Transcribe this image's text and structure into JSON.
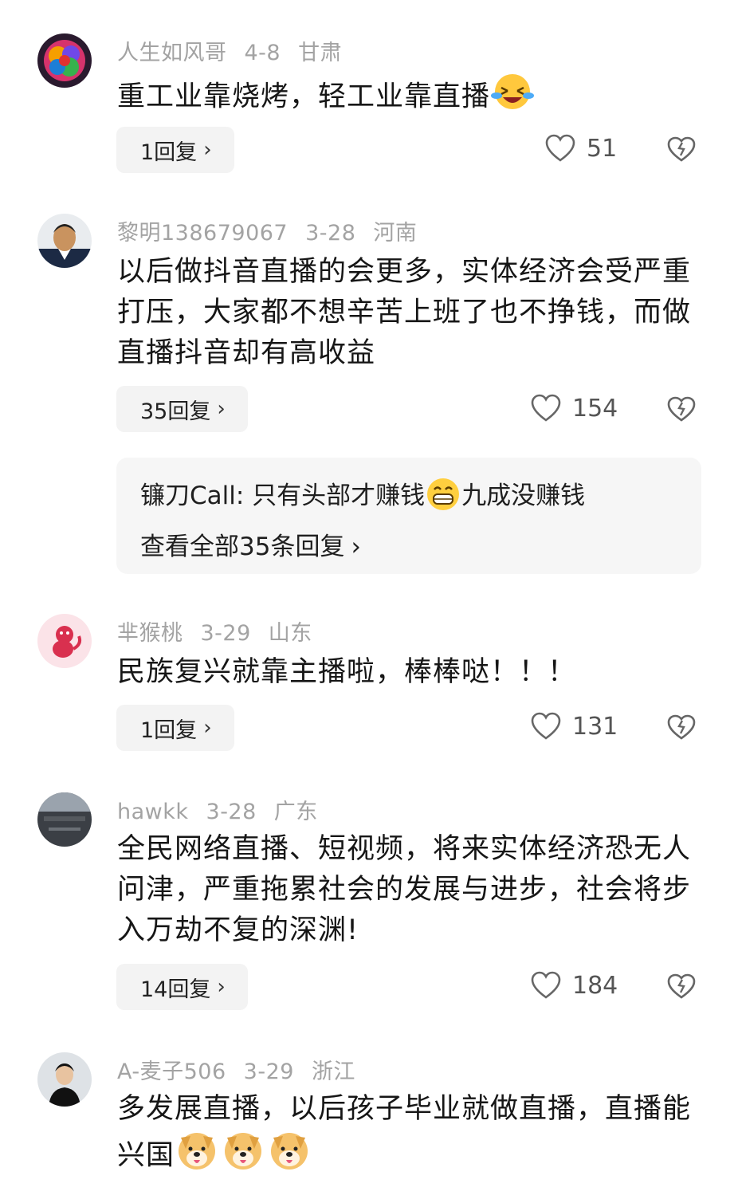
{
  "comments": [
    {
      "username": "人生如风哥",
      "date": "4-8",
      "location": "甘肃",
      "text": "重工业靠烧烤，轻工业靠直播",
      "emoji": "laughing-crying-emoji",
      "replies_label": "1回复",
      "likes": "51"
    },
    {
      "username": "黎明138679067",
      "date": "3-28",
      "location": "河南",
      "text": "以后做抖音直播的会更多，实体经济会受严重打压，大家都不想辛苦上班了也不挣钱，而做直播抖音却有高收益",
      "replies_label": "35回复",
      "likes": "154",
      "sub_reply": {
        "author": "镰刀Call",
        "text_before": "只有头部才赚钱",
        "emoji": "grinning-emoji",
        "text_after": "九成没赚钱",
        "view_all": "查看全部35条回复"
      }
    },
    {
      "username": "芈猴桃",
      "date": "3-29",
      "location": "山东",
      "text": "民族复兴就靠主播啦，棒棒哒！！！",
      "replies_label": "1回复",
      "likes": "131"
    },
    {
      "username": "hawkk",
      "date": "3-28",
      "location": "广东",
      "text": "全民网络直播、短视频，将来实体经济恐无人问津，严重拖累社会的发展与进步，社会将步入万劫不复的深渊!",
      "replies_label": "14回复",
      "likes": "184"
    },
    {
      "username": "A-麦子506",
      "date": "3-29",
      "location": "浙江",
      "text": "多发展直播，以后孩子毕业就做直播，直播能兴国",
      "emoji": "doge-emoji"
    }
  ],
  "colors": {
    "meta": "#a3a3a3",
    "text": "#161616",
    "reply_bg": "#f3f3f3",
    "icon": "#555555"
  },
  "icons": {
    "like": "heart-outline-icon",
    "dislike": "broken-heart-icon",
    "chevron": "chevron-right-icon"
  }
}
